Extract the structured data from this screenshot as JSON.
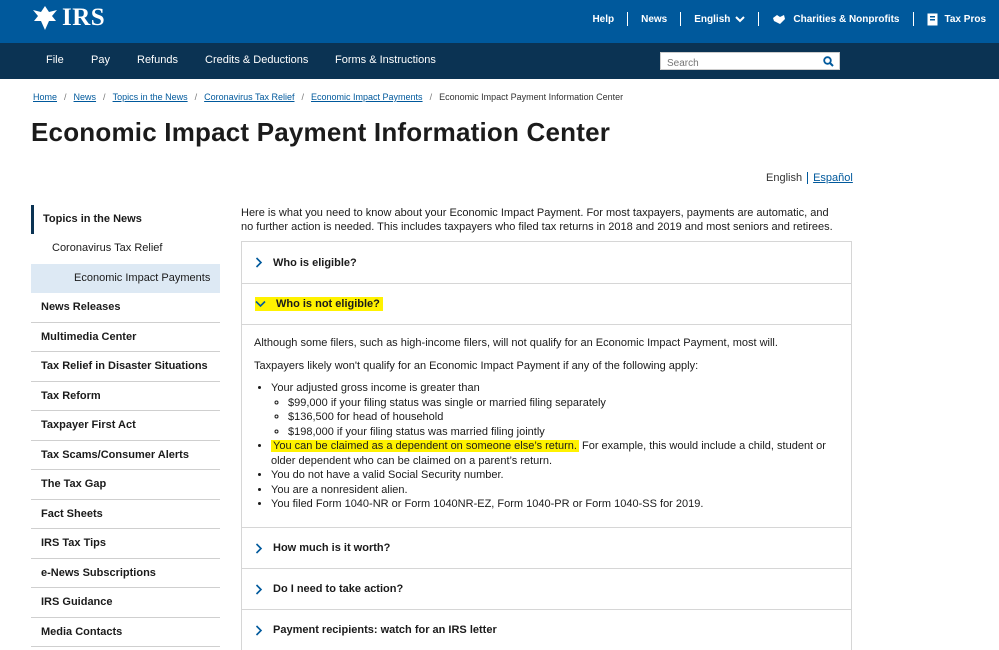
{
  "header": {
    "logo_text": "IRS",
    "links": {
      "help": "Help",
      "news": "News",
      "language": "English",
      "charities": "Charities & Nonprofits",
      "tax_pros": "Tax Pros"
    }
  },
  "nav": {
    "items": [
      "File",
      "Pay",
      "Refunds",
      "Credits & Deductions",
      "Forms & Instructions"
    ],
    "search_placeholder": "Search"
  },
  "breadcrumb": {
    "items": [
      "Home",
      "News",
      "Topics in the News",
      "Coronavirus Tax Relief",
      "Economic Impact Payments"
    ],
    "current": "Economic Impact Payment Information Center"
  },
  "page_title": "Economic Impact Payment Information Center",
  "language_switch": {
    "current": "English",
    "other": "Español"
  },
  "sidebar": {
    "top": "Topics in the News",
    "sub": "Coronavirus Tax Relief",
    "active": "Economic Impact Payments",
    "items": [
      "News Releases",
      "Multimedia Center",
      "Tax Relief in Disaster Situations",
      "Tax Reform",
      "Taxpayer First Act",
      "Tax Scams/Consumer Alerts",
      "The Tax Gap",
      "Fact Sheets",
      "IRS Tax Tips",
      "e-News Subscriptions",
      "IRS Guidance",
      "Media Contacts"
    ]
  },
  "intro": "Here is what you need to know about your Economic Impact Payment. For most taxpayers, payments are automatic, and no further action is needed. This includes taxpayers who filed tax returns in 2018 and 2019 and most seniors and retirees.",
  "accordion": {
    "who_eligible": "Who is eligible?",
    "who_not_eligible": "Who is not eligible?",
    "body": {
      "p1": "Although some filers, such as high-income filers, will not qualify for an Economic Impact Payment, most will.",
      "p2": "Taxpayers likely won't qualify for an Economic Impact Payment if any of the following apply:",
      "agi": "Your adjusted gross income is greater than",
      "agi_single": "$99,000 if your filing status was single or married filing separately",
      "agi_hoh": "$136,500 for head of household",
      "agi_joint": "$198,000 if your filing status was married filing jointly",
      "dependent_hl": "You can be claimed as a dependent on someone else’s return.",
      "dependent_rest": " For example, this would include a child, student or older dependent who can be claimed on a parent’s return.",
      "ssn": "You do not have a valid Social Security number.",
      "nonresident": "You are a nonresident alien.",
      "forms": "You filed Form 1040-NR or Form 1040NR-EZ, Form 1040-PR or Form 1040-SS for 2019."
    },
    "how_much": "How much is it worth?",
    "take_action": "Do I need to take action?",
    "payment_recipients": "Payment recipients: watch for an IRS letter"
  },
  "colors": {
    "header_blue": "#00599c",
    "nav_dark": "#0b3353",
    "link_blue": "#00599c",
    "highlight": "#fff200",
    "sidebar_active_bg": "#dde9f4"
  }
}
